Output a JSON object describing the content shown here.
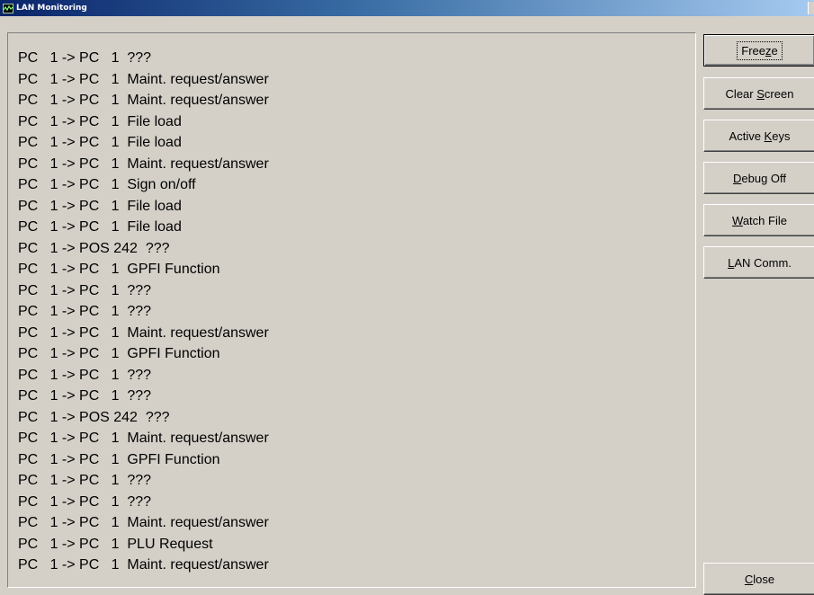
{
  "window": {
    "title": "LAN Monitoring"
  },
  "log_lines": [
    "PC   1 -> PC   1  ???",
    "PC   1 -> PC   1  Maint. request/answer",
    "PC   1 -> PC   1  Maint. request/answer",
    "PC   1 -> PC   1  File load",
    "PC   1 -> PC   1  File load",
    "PC   1 -> PC   1  Maint. request/answer",
    "PC   1 -> PC   1  Sign on/off",
    "PC   1 -> PC   1  File load",
    "PC   1 -> PC   1  File load",
    "PC   1 -> POS 242  ???",
    "PC   1 -> PC   1  GPFI Function",
    "PC   1 -> PC   1  ???",
    "PC   1 -> PC   1  ???",
    "PC   1 -> PC   1  Maint. request/answer",
    "PC   1 -> PC   1  GPFI Function",
    "PC   1 -> PC   1  ???",
    "PC   1 -> PC   1  ???",
    "PC   1 -> POS 242  ???",
    "PC   1 -> PC   1  Maint. request/answer",
    "PC   1 -> PC   1  GPFI Function",
    "PC   1 -> PC   1  ???",
    "PC   1 -> PC   1  ???",
    "PC   1 -> PC   1  Maint. request/answer",
    "PC   1 -> PC   1  PLU Request",
    "PC   1 -> PC   1  Maint. request/answer"
  ],
  "buttons": {
    "freeze": {
      "pre": "Free",
      "mnemonic": "z",
      "post": "e"
    },
    "clear_screen": {
      "pre": "Clear ",
      "mnemonic": "S",
      "post": "creen"
    },
    "active_keys": {
      "pre": "Active ",
      "mnemonic": "K",
      "post": "eys"
    },
    "debug_off": {
      "pre": "",
      "mnemonic": "D",
      "post": "ebug Off"
    },
    "watch_file": {
      "pre": "",
      "mnemonic": "W",
      "post": "atch File"
    },
    "lan_comm": {
      "pre": "",
      "mnemonic": "L",
      "post": "AN Comm."
    },
    "close": {
      "pre": "",
      "mnemonic": "C",
      "post": "lose"
    }
  },
  "icons": {
    "title_icon": "monitor-wave-icon"
  }
}
